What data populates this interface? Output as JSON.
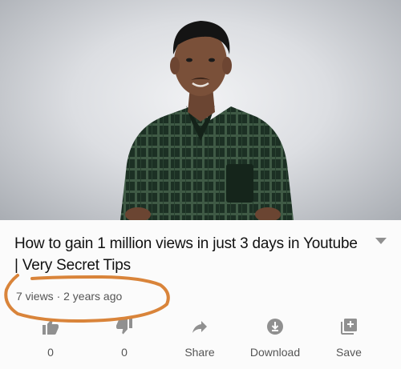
{
  "video": {
    "title": "How to gain 1 million views in just 3 days in Youtube | Very Secret Tips",
    "meta": "7 views · 2 years ago"
  },
  "actions": [
    {
      "icon": "thumbs-up-icon",
      "label": "0"
    },
    {
      "icon": "thumbs-down-icon",
      "label": "0"
    },
    {
      "icon": "share-icon",
      "label": "Share"
    },
    {
      "icon": "download-icon",
      "label": "Download"
    },
    {
      "icon": "save-playlist-icon",
      "label": "Save"
    }
  ],
  "colors": {
    "highlight_circle": "#d9843a",
    "icon_gray": "#909090",
    "shirt": "#1f3326"
  }
}
